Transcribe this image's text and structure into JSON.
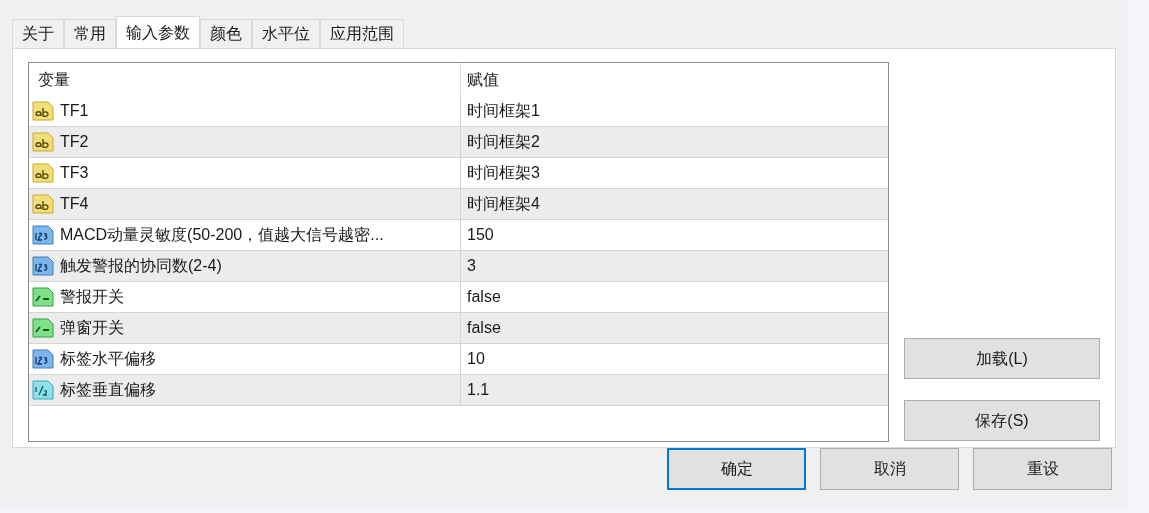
{
  "tabs": [
    {
      "label": "关于",
      "selected": false
    },
    {
      "label": "常用",
      "selected": false
    },
    {
      "label": "输入参数",
      "selected": true
    },
    {
      "label": "颜色",
      "selected": false
    },
    {
      "label": "水平位",
      "selected": false
    },
    {
      "label": "应用范围",
      "selected": false
    }
  ],
  "table": {
    "columns": [
      "变量",
      "赋值"
    ],
    "rows": [
      {
        "kind": "string",
        "name": "TF1",
        "value": "时间框架1"
      },
      {
        "kind": "string",
        "name": "TF2",
        "value": "时间框架2"
      },
      {
        "kind": "string",
        "name": "TF3",
        "value": "时间框架3"
      },
      {
        "kind": "string",
        "name": "TF4",
        "value": "时间框架4"
      },
      {
        "kind": "int",
        "name": "MACD动量灵敏度(50-200，值越大信号越密...",
        "value": "150"
      },
      {
        "kind": "int",
        "name": "触发警报的协同数(2-4)",
        "value": "3"
      },
      {
        "kind": "bool",
        "name": "警报开关",
        "value": "false"
      },
      {
        "kind": "bool",
        "name": "弹窗开关",
        "value": "false"
      },
      {
        "kind": "int",
        "name": "标签水平偏移",
        "value": "10"
      },
      {
        "kind": "double",
        "name": "标签垂直偏移",
        "value": "1.1"
      }
    ]
  },
  "side_buttons": [
    "加载(L)",
    "保存(S)"
  ],
  "buttons": [
    {
      "label": "确定",
      "selected": true
    },
    {
      "label": "取消",
      "selected": false
    },
    {
      "label": "重设",
      "selected": false
    }
  ]
}
